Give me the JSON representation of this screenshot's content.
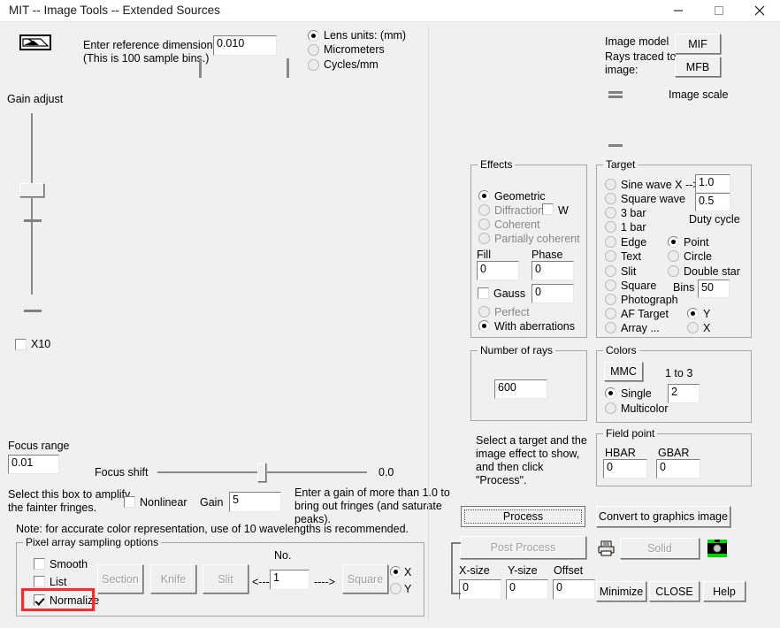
{
  "window": {
    "title": "MIT -- Image Tools -- Extended Sources",
    "minimize": "minimize",
    "maximize": "maximize",
    "close": "close"
  },
  "top": {
    "lens_icon": "lens-prism-icon",
    "ref_line1": "Enter reference dimension --->",
    "ref_line2": "(This is 100 sample bins.)",
    "ref_value": "0.010",
    "units": {
      "opt1": "Lens units: (mm)",
      "opt2": "Micrometers",
      "opt3": "Cycles/mm",
      "selected": "Lens units: (mm)"
    }
  },
  "gain": {
    "label": "Gain adjust",
    "x10_label": "X10",
    "x10_checked": false
  },
  "image_model": {
    "label": "Image model",
    "rays_label_1": "Rays traced to",
    "rays_label_2": "image:",
    "mif": "MIF",
    "mfb": "MFB",
    "image_scale_label": "Image scale"
  },
  "effects": {
    "legend": "Effects",
    "options": [
      {
        "label": "Geometric",
        "selected": true,
        "disabled": false
      },
      {
        "label": "Diffraction",
        "selected": false,
        "disabled": true
      },
      {
        "label": "Coherent",
        "selected": false,
        "disabled": true
      },
      {
        "label": "Partially coherent",
        "selected": false,
        "disabled": true
      }
    ],
    "w_label": "W",
    "w_checked": false,
    "fill_label": "Fill",
    "fill_value": "0",
    "phase_label": "Phase",
    "phase_value": "0",
    "gauss_label": "Gauss",
    "gauss_checked": false,
    "gauss_value": "0",
    "perfect_label": "Perfect",
    "perfect_selected": false,
    "aberrations_label": "With aberrations",
    "aberrations_selected": true
  },
  "target": {
    "legend": "Target",
    "options": [
      {
        "label": "Sine wave X -->",
        "selected": false
      },
      {
        "label": "Square wave",
        "selected": false
      },
      {
        "label": "3 bar",
        "selected": false
      },
      {
        "label": "1 bar",
        "selected": false
      },
      {
        "label": "Edge",
        "selected": false
      },
      {
        "label": "Text",
        "selected": false
      },
      {
        "label": "Slit",
        "selected": false
      },
      {
        "label": "Square",
        "selected": false
      },
      {
        "label": "Photograph",
        "selected": false
      },
      {
        "label": "AF Target",
        "selected": false
      },
      {
        "label": "Array ...",
        "selected": false
      }
    ],
    "sine_value": "1.0",
    "square_value": "0.5",
    "duty_cycle_label": "Duty cycle",
    "shape_options": [
      {
        "label": "Point",
        "selected": true
      },
      {
        "label": "Circle",
        "selected": false
      },
      {
        "label": "Double star",
        "selected": false
      }
    ],
    "bins_label": "Bins",
    "bins_value": "50",
    "axis_options": [
      {
        "label": "Y",
        "selected": true
      },
      {
        "label": "X",
        "selected": false
      }
    ]
  },
  "rays": {
    "legend": "Number of rays",
    "value": "600"
  },
  "hint": {
    "line1": "Select a target and the",
    "line2": "image effect to show,",
    "line3": "and then click",
    "line4": "\"Process\"."
  },
  "colors": {
    "legend": "Colors",
    "mmc_button": "MMC",
    "range_label": "1 to 3",
    "range_value": "2",
    "single_label": "Single",
    "single_selected": true,
    "multicolor_label": "Multicolor",
    "multicolor_selected": false
  },
  "field_point": {
    "legend": "Field point",
    "hbar_label": "HBAR",
    "hbar_value": "0",
    "gbar_label": "GBAR",
    "gbar_value": "0"
  },
  "focus": {
    "range_label": "Focus range",
    "range_value": "0.01",
    "shift_label": "Focus shift",
    "shift_value": "0.0"
  },
  "amplify": {
    "note_line1": "Select this box to amplify",
    "note_line2": "the fainter fringes.",
    "nonlinear_label": "Nonlinear",
    "nonlinear_checked": false,
    "gain_label": "Gain",
    "gain_value": "5",
    "gain_note_l1": "Enter a gain of more than 1.0 to",
    "gain_note_l2": "bring out fringes (and saturate",
    "gain_note_l3": "peaks).",
    "wavelength_note": "Note: for accurate color representation, use of 10 wavelengths is recommended."
  },
  "pixel_array": {
    "legend": "Pixel array sampling options",
    "smooth_label": "Smooth",
    "smooth_checked": false,
    "list_label": "List",
    "list_checked": false,
    "normalize_label": "Normalize",
    "normalize_checked": true,
    "section_button": "Section",
    "knife_button": "Knife",
    "slit_button": "Slit",
    "square_button": "Square",
    "no_label": "No.",
    "left_arrow": "<----",
    "right_arrow": "---->",
    "no_value": "1",
    "axis_x": "X",
    "axis_y": "Y",
    "axis_selected": "X",
    "highlight_color": "#ff2b2b"
  },
  "actions": {
    "process": "Process",
    "convert": "Convert to graphics image",
    "post_process": "Post Process",
    "solid": "Solid",
    "print_icon": "printer-icon",
    "camera_icon": "camera-icon",
    "xsize_label": "X-size",
    "xsize_value": "0",
    "ysize_label": "Y-size",
    "ysize_value": "0",
    "offset_label": "Offset",
    "offset_value": "0",
    "minimize": "Minimize",
    "close": "CLOSE",
    "help": "Help"
  }
}
